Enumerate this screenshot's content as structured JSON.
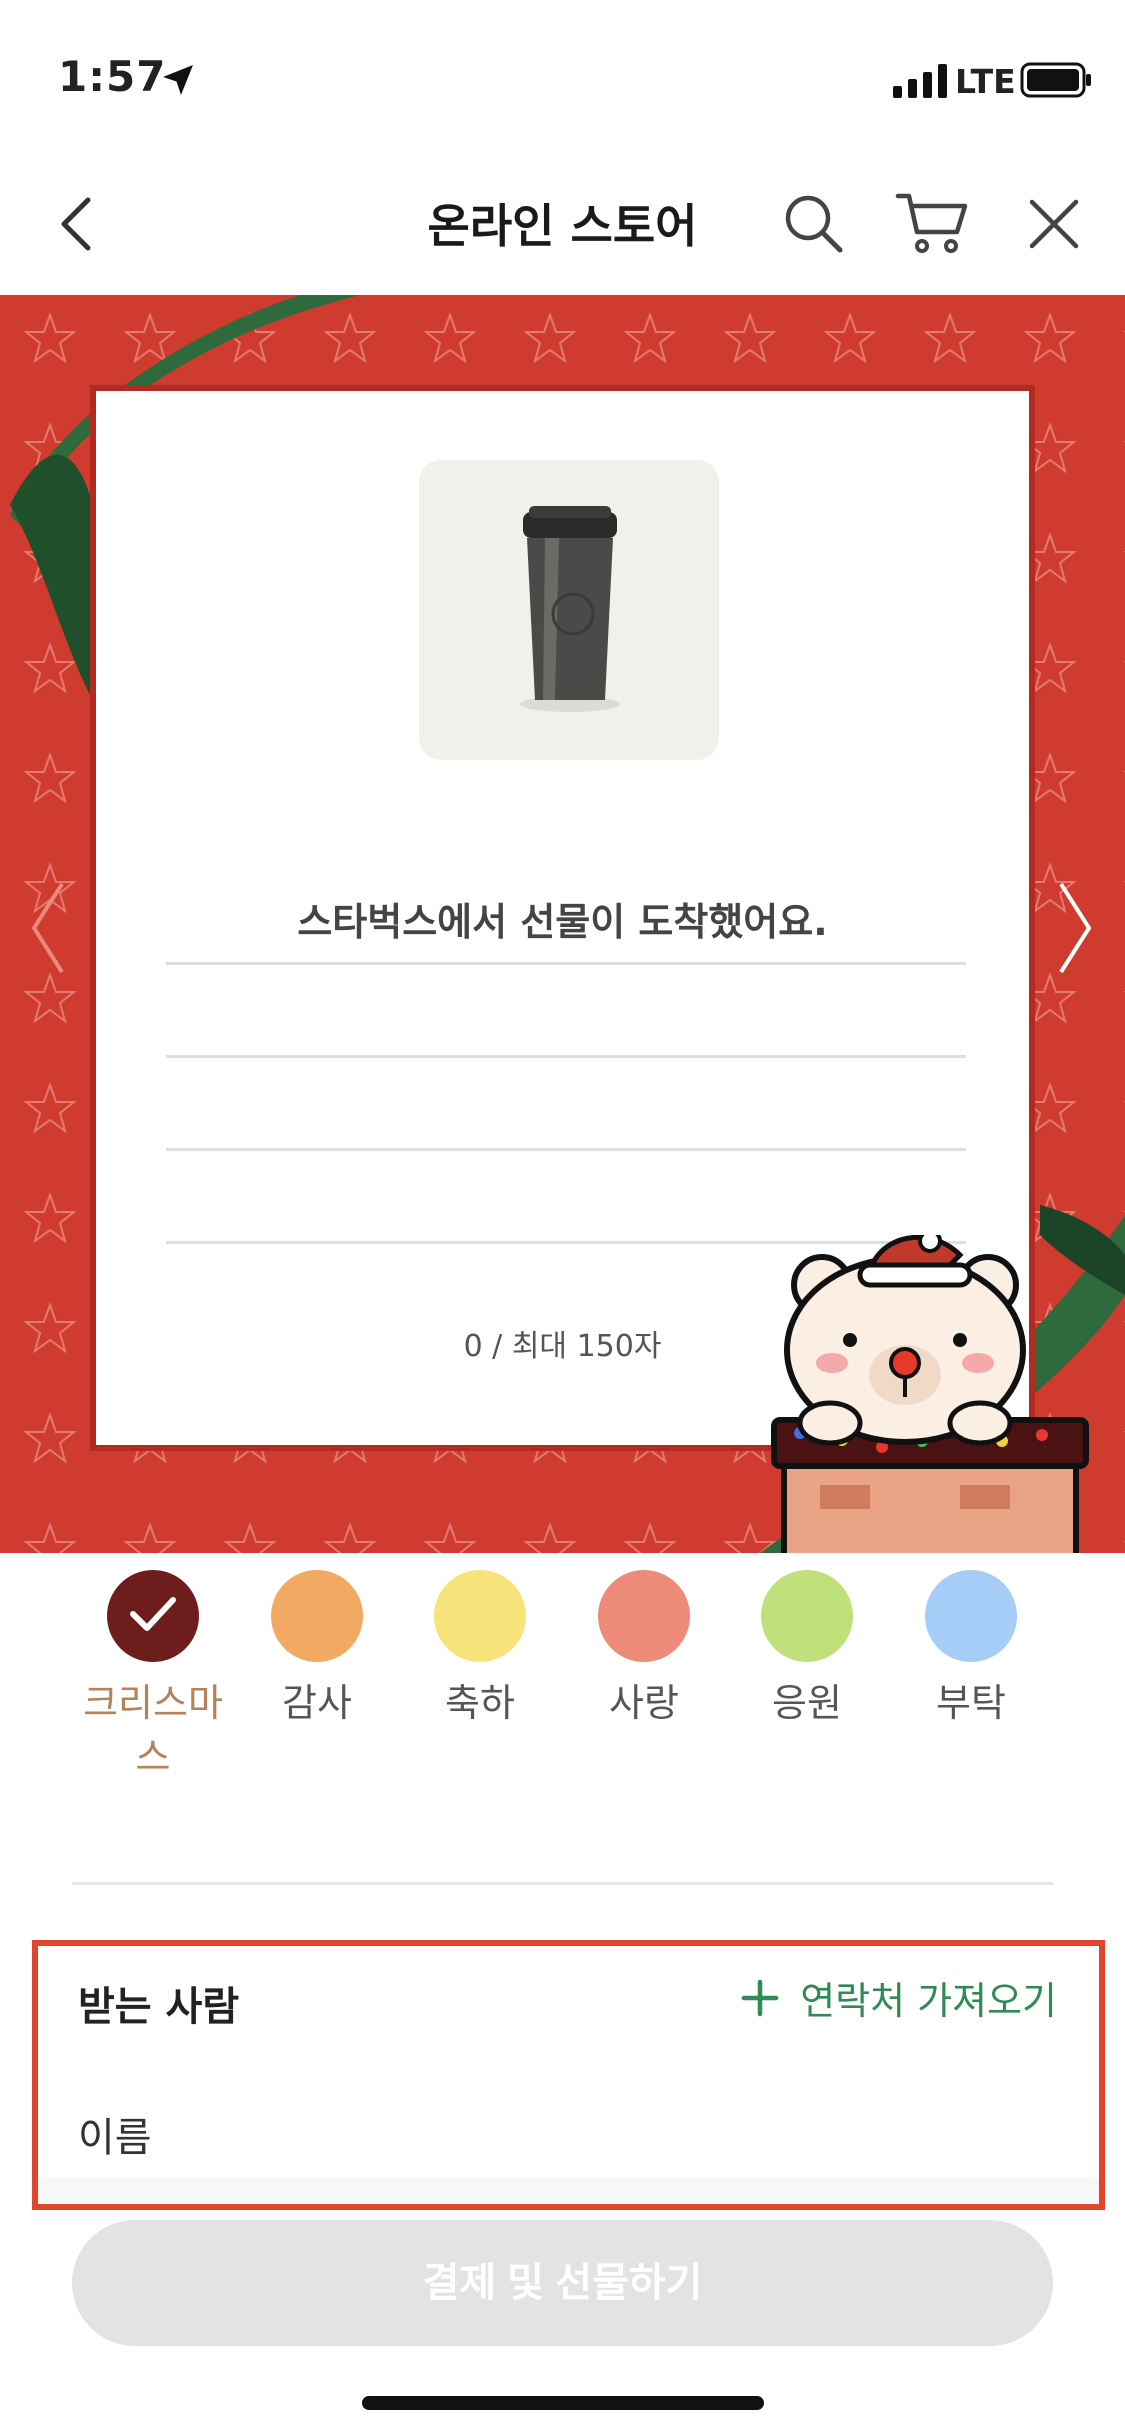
{
  "status_bar": {
    "time": "1:57",
    "network": "LTE"
  },
  "nav": {
    "title": "온라인 스토어"
  },
  "card": {
    "message": "스타벅스에서 선물이 도착했어요.",
    "char_count": "0 / 최대 150자"
  },
  "themes": [
    {
      "label": "크리스마스",
      "color": "#6e1d1d",
      "selected": true
    },
    {
      "label": "감사",
      "color": "#f2a962",
      "selected": false
    },
    {
      "label": "축하",
      "color": "#f8e27a",
      "selected": false
    },
    {
      "label": "사랑",
      "color": "#ee8a78",
      "selected": false
    },
    {
      "label": "응원",
      "color": "#bfe07a",
      "selected": false
    },
    {
      "label": "부탁",
      "color": "#a6cdf7",
      "selected": false
    }
  ],
  "recipient": {
    "title": "받는 사람",
    "contacts_label": "연락처 가져오기",
    "name_placeholder": "이름"
  },
  "pay_button": {
    "label": "결제 및 선물하기"
  },
  "colors": {
    "card_bg": "#cf3b2e",
    "ribbon": "#2e6a3c",
    "accent_green": "#2f8a55",
    "highlight": "#e2452e"
  }
}
